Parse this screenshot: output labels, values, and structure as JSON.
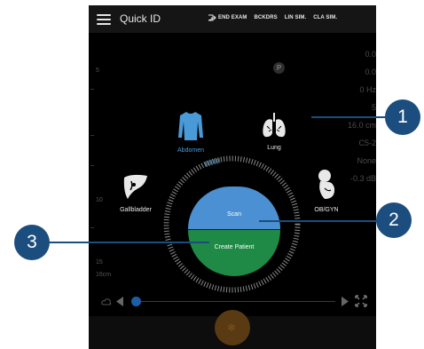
{
  "header": {
    "title": "Quick ID",
    "actions": [
      "END EXAM",
      "BCKDRS",
      "LIN SIM.",
      "CLA SIM."
    ]
  },
  "depth_ruler": {
    "labels": [
      "5",
      "10",
      "15",
      "16cm"
    ]
  },
  "right_values": [
    "0.0",
    "0.0",
    "0 Hz",
    "5",
    "16.0 cm",
    "C5-2",
    "None",
    "-0.3 dB"
  ],
  "probe_badge": "P",
  "presets": {
    "abdomen": "Abdomen",
    "lung": "Lung",
    "gallbladder": "Gallbladder",
    "obgyn": "OB/GYN"
  },
  "buttons": {
    "scan": "Scan",
    "create_patient": "Create Patient"
  },
  "callouts": [
    "1",
    "2",
    "3"
  ],
  "colors": {
    "scan_blue": "#4a90d2",
    "patient_green": "#1e8a46",
    "callout_navy": "#1b4d7e",
    "active_blue": "#4a9ad8",
    "freeze_amber": "#5a3a12"
  }
}
